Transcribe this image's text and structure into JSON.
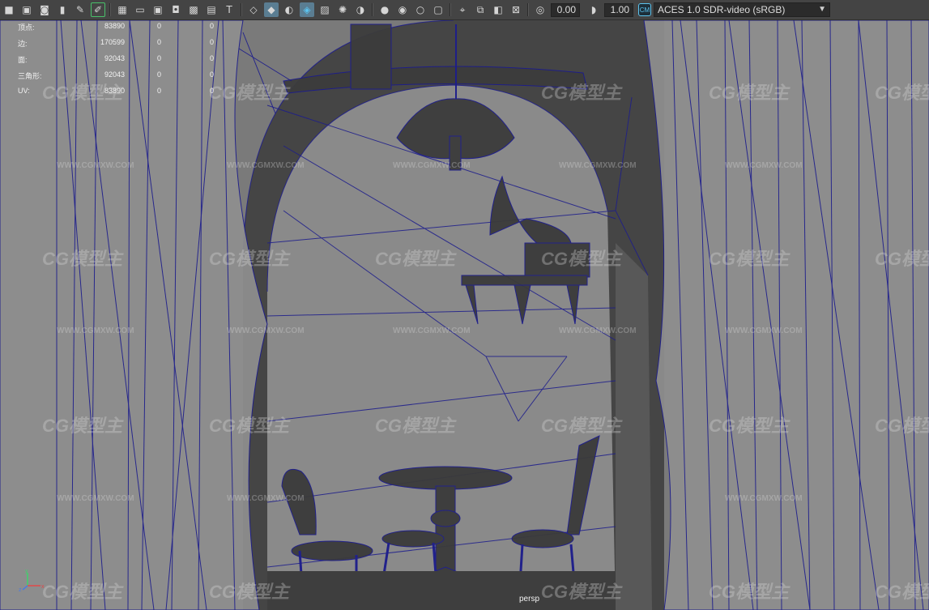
{
  "toolbar": {
    "icons": [
      "camera-icon",
      "camera-attr-icon",
      "bookmark-icon",
      "image-plane-icon",
      "grease-pencil-icon",
      "pencil-icon",
      "grid-icon",
      "film-gate-icon",
      "resolution-gate-icon",
      "gate-mask-icon",
      "field-chart-icon",
      "safe-action-icon",
      "safe-title-icon",
      "wireframe-icon",
      "smooth-shade-icon",
      "use-default-material-icon",
      "wireframe-on-shaded-icon",
      "xray-icon",
      "use-all-lights-icon",
      "shadows-icon",
      "isolate-select-icon",
      "ambient-occlusion-icon",
      "motion-blur-icon",
      "anti-aliasing-icon",
      "depth-of-field-icon",
      "frame-icon",
      "xray-joints-icon",
      "xray-active-icon",
      "exposure-icon",
      "gamma-icon",
      "color-management-icon"
    ],
    "exposure_value": "0.00",
    "gamma_value": "1.00",
    "view_transform": "ACES 1.0 SDR-video (sRGB)",
    "accent": "#5cc3ee"
  },
  "hud": {
    "rows": [
      {
        "label": "顶点:",
        "v1": "83890",
        "v2": "0",
        "v3": "0"
      },
      {
        "label": "边:",
        "v1": "170599",
        "v2": "0",
        "v3": "0"
      },
      {
        "label": "面:",
        "v1": "92043",
        "v2": "0",
        "v3": "0"
      },
      {
        "label": "三角形:",
        "v1": "92043",
        "v2": "0",
        "v3": "0"
      },
      {
        "label": "UV:",
        "v1": "83890",
        "v2": "0",
        "v3": "0"
      }
    ]
  },
  "viewport": {
    "camera": "persp",
    "axes": {
      "y": "y",
      "x": "x",
      "z": "z"
    },
    "wireframe_color": "#1c1c8c"
  },
  "watermarks": {
    "logo": "CG模型主",
    "site": "WWW.CGMXW.COM"
  }
}
